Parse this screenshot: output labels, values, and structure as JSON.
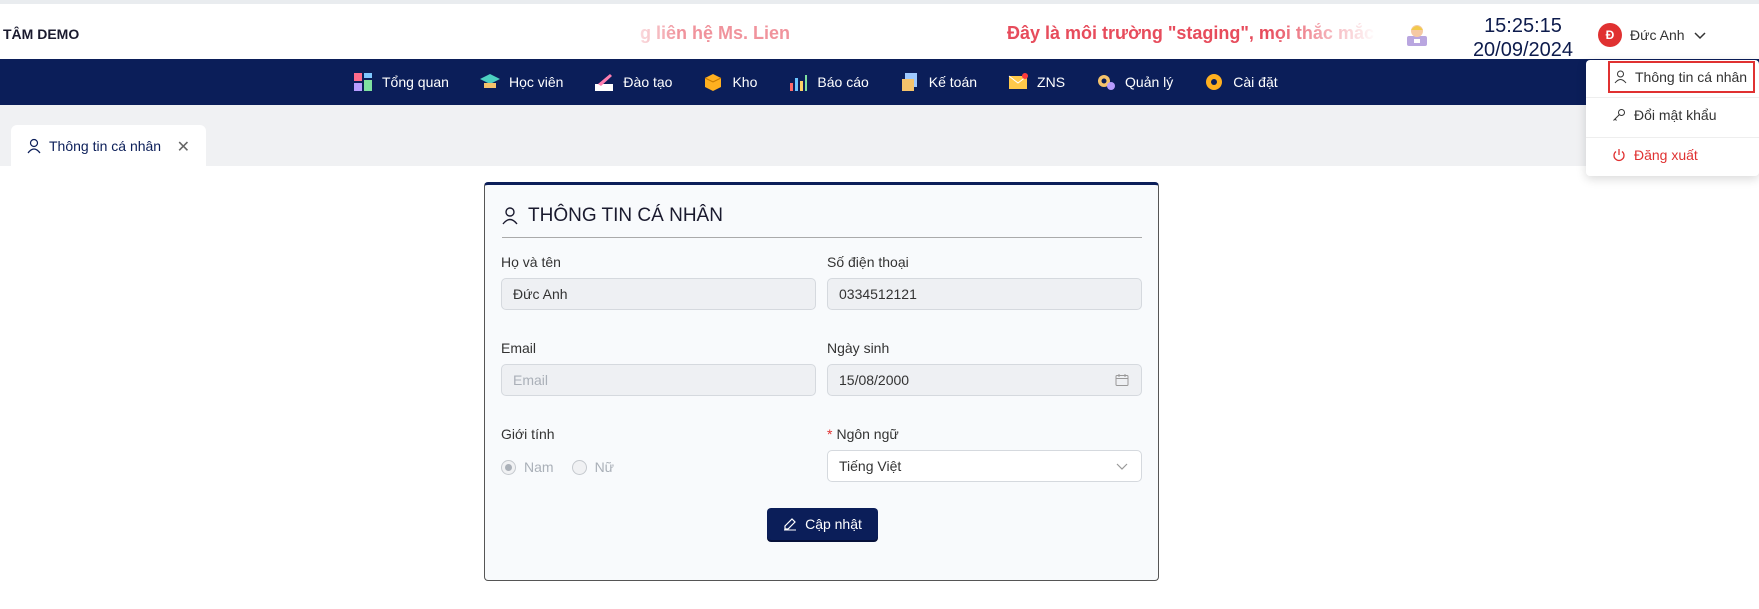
{
  "header": {
    "brand": "TÂM DEMO",
    "marquee_left": "g liên hệ Ms. Lien",
    "marquee_right": "Đây là môi trường \"staging\", mọi thắc mắc vui l",
    "time": "15:25:15",
    "date": "20/09/2024",
    "user_initial": "Đ",
    "user_name": "Đức Anh"
  },
  "nav": {
    "items": [
      {
        "label": "Tổng quan",
        "icon": "dashboard-icon"
      },
      {
        "label": "Học viên",
        "icon": "graduation-cap-icon"
      },
      {
        "label": "Đào tạo",
        "icon": "writing-icon"
      },
      {
        "label": "Kho",
        "icon": "box-icon"
      },
      {
        "label": "Báo cáo",
        "icon": "bar-chart-icon"
      },
      {
        "label": "Kế toán",
        "icon": "ledger-icon"
      },
      {
        "label": "ZNS",
        "icon": "mail-icon"
      },
      {
        "label": "Quản lý",
        "icon": "gear-manage-icon"
      },
      {
        "label": "Cài đặt",
        "icon": "settings-gear-icon"
      }
    ]
  },
  "tab": {
    "label": "Thông tin cá nhân"
  },
  "form": {
    "title": "THÔNG TIN CÁ NHÂN",
    "fullname_label": "Họ và tên",
    "fullname_value": "Đức Anh",
    "phone_label": "Số điện thoại",
    "phone_value": "0334512121",
    "email_label": "Email",
    "email_placeholder": "Email",
    "dob_label": "Ngày sinh",
    "dob_value": "15/08/2000",
    "gender_label": "Giới tính",
    "gender_male": "Nam",
    "gender_female": "Nữ",
    "language_required": "*",
    "language_label": "Ngôn ngữ",
    "language_value": "Tiếng Việt",
    "update_label": "Cập nhật"
  },
  "dropdown": {
    "profile": "Thông tin cá nhân",
    "change_password": "Đổi mật khẩu",
    "logout": "Đăng xuất"
  },
  "colors": {
    "primary": "#0b1e59",
    "danger": "#e03131",
    "marquee": "#e74c5c"
  }
}
